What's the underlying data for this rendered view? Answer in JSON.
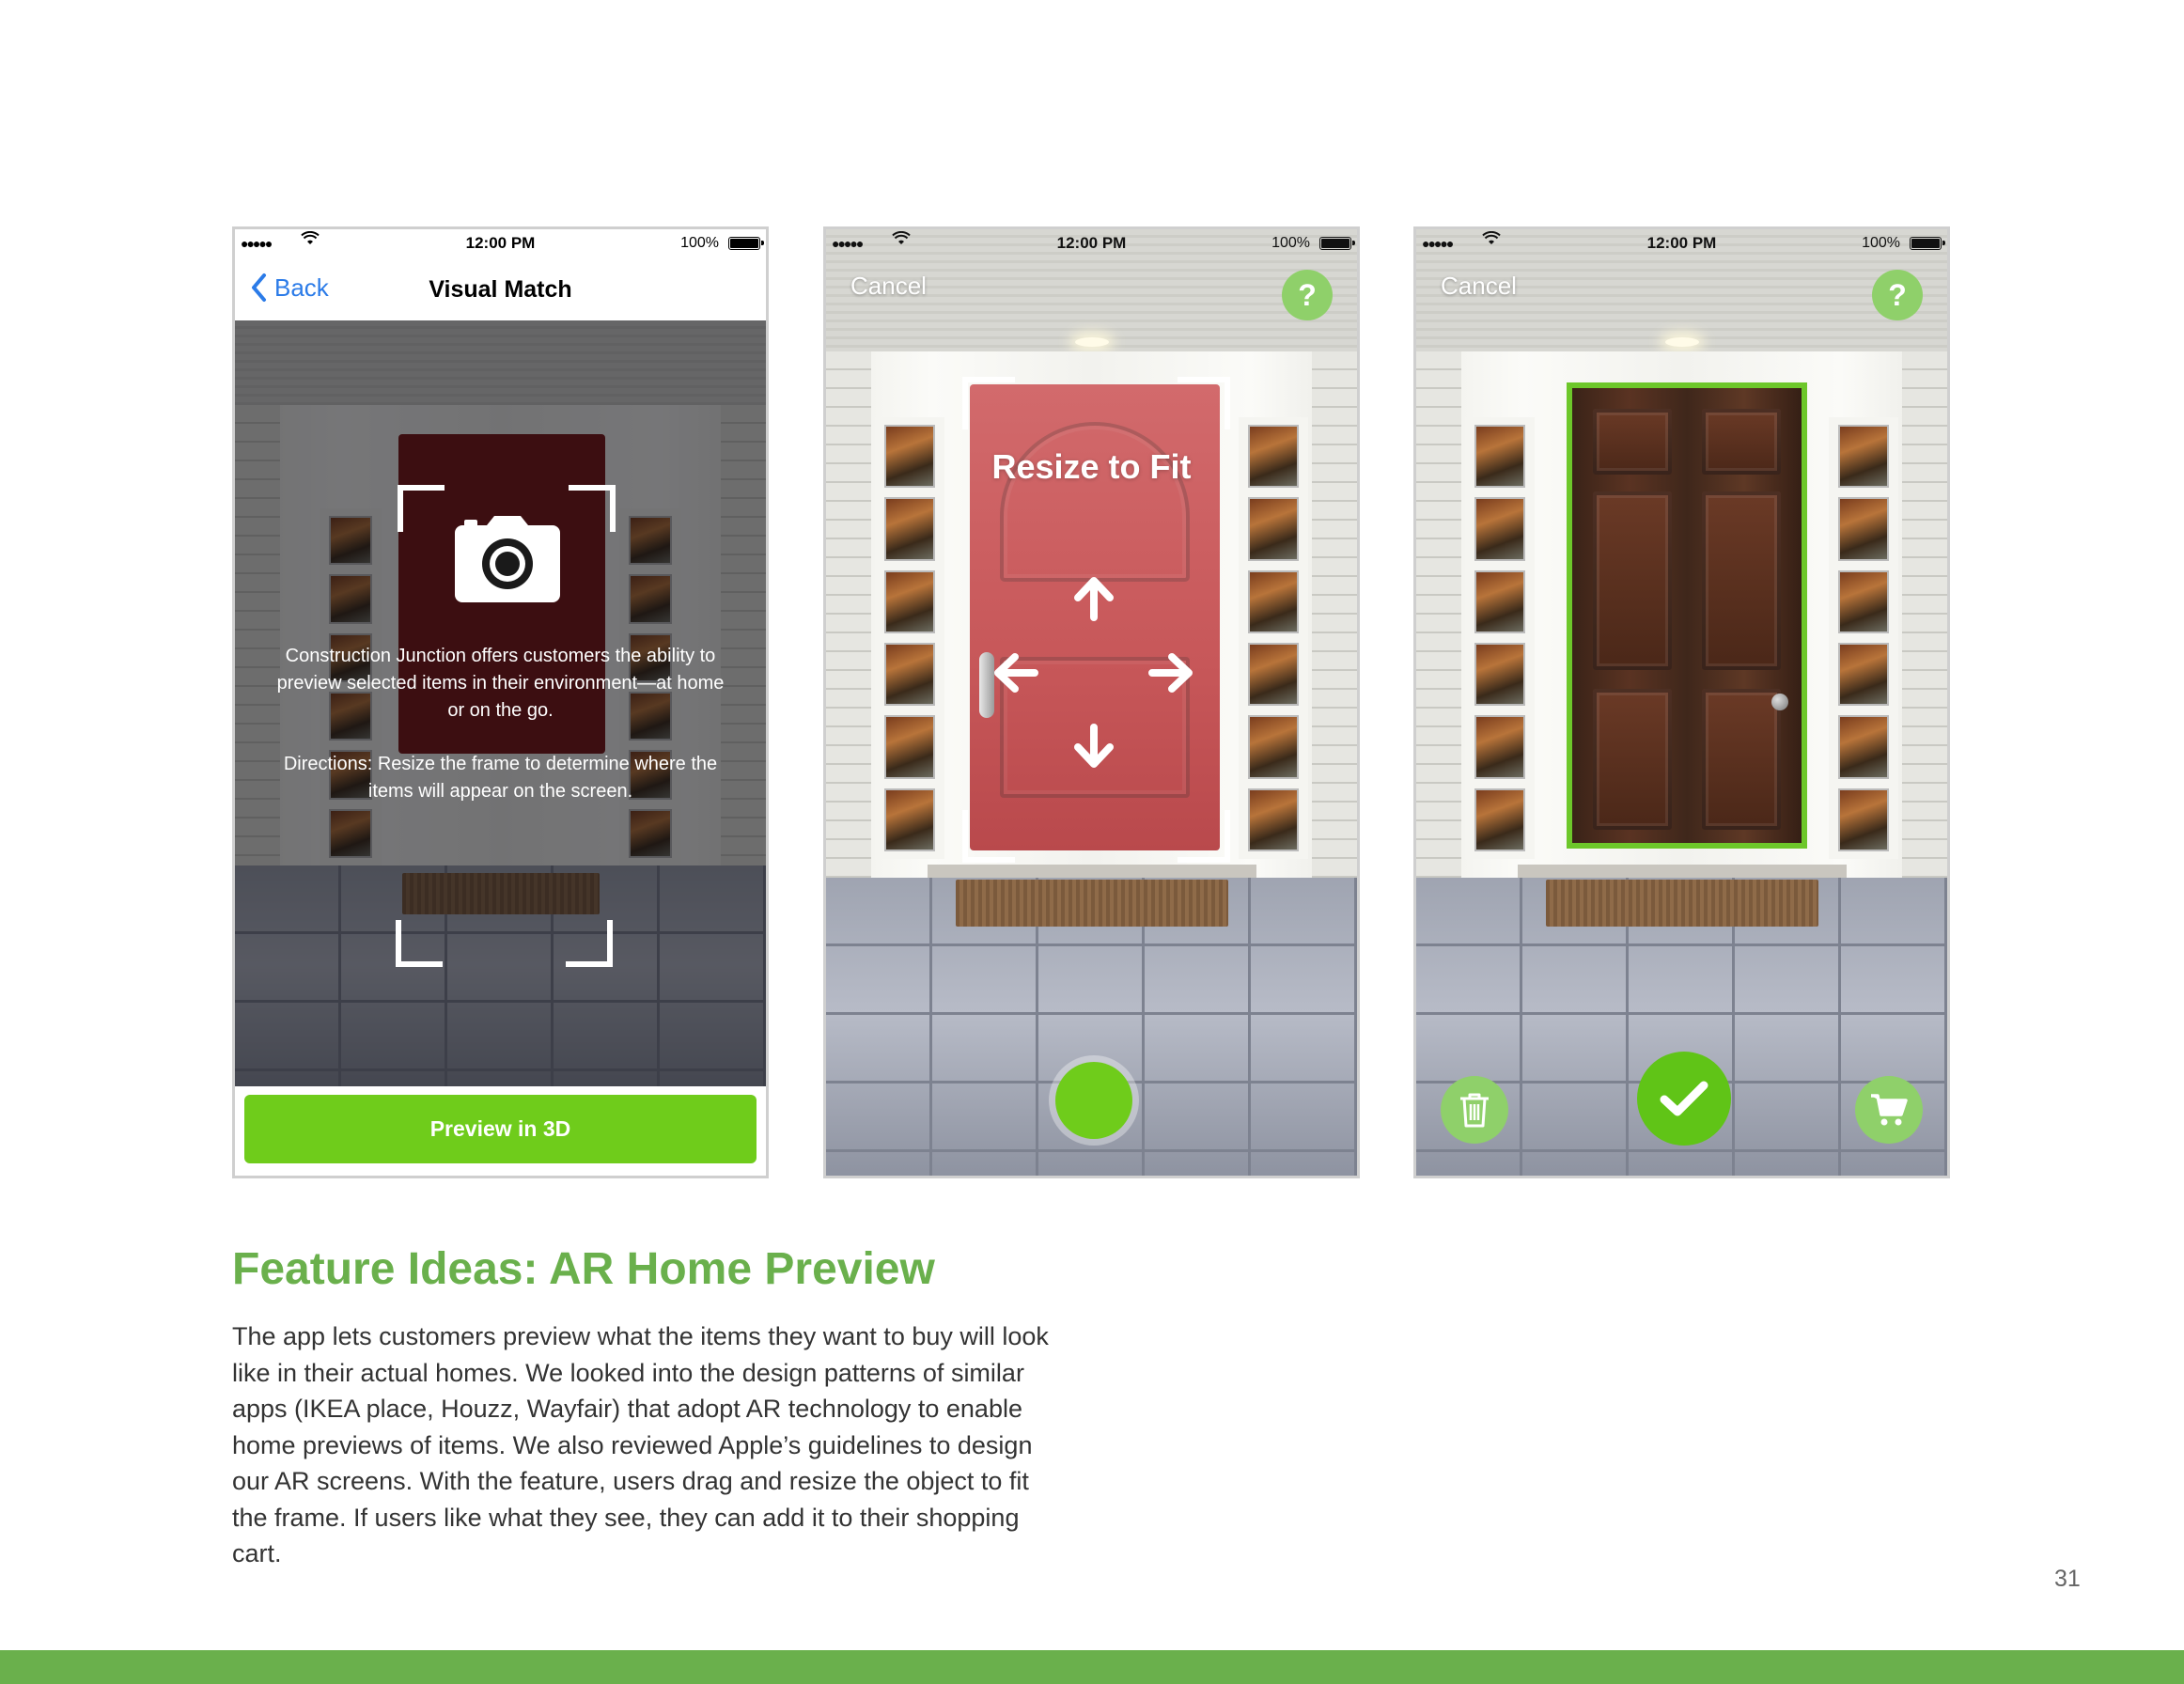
{
  "status_bar": {
    "signal": "●●●●●",
    "time": "12:00 PM",
    "battery": "100%"
  },
  "screen1": {
    "back_label": "Back",
    "title": "Visual Match",
    "intro": "Construction Junction offers customers the ability to preview selected items in their environment—at home or on the go.",
    "directions": "Directions: Resize the frame to determine where the items will appear on the screen.",
    "preview_button": "Preview in 3D"
  },
  "screen2": {
    "cancel_label": "Cancel",
    "help_label": "?",
    "resize_label": "Resize to Fit"
  },
  "screen3": {
    "cancel_label": "Cancel",
    "help_label": "?"
  },
  "section": {
    "title": "Feature Ideas: AR Home Preview",
    "body": "The app lets customers preview what the items they want to buy will look like in their actual homes. We looked into the design patterns of similar apps (IKEA place, Houzz, Wayfair) that adopt AR technology to enable home previews of items. We also reviewed Apple’s guidelines to design our AR screens. With the feature, users drag and resize the object to fit the frame. If users like what they see, they can add it to their shopping cart."
  },
  "page_number": "31",
  "colors": {
    "brand_green": "#6ab04c",
    "button_green": "#6fcc1b",
    "ios_blue": "#2b7be8"
  },
  "icons": [
    "signal-icon",
    "wifi-icon",
    "battery-icon",
    "chevron-left-icon",
    "camera-icon",
    "arrow-up-icon",
    "arrow-down-icon",
    "arrow-left-icon",
    "arrow-right-icon",
    "trash-icon",
    "checkmark-icon",
    "cart-icon"
  ]
}
